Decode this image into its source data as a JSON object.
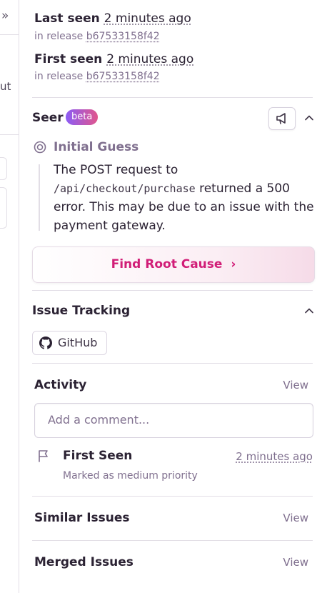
{
  "left_pane": {
    "collapse_glyph": "»",
    "cut_text": "ut"
  },
  "last_seen": {
    "label": "Last seen",
    "relative": "2 minutes ago",
    "release_prefix": "in release",
    "release": "b67533158f42"
  },
  "first_seen": {
    "label": "First seen",
    "relative": "2 minutes ago",
    "release_prefix": "in release",
    "release": "b67533158f42"
  },
  "seer": {
    "title": "Seer",
    "badge": "beta",
    "initial_guess": {
      "title": "Initial Guess",
      "text_before": "The POST request to ",
      "code": "/api/checkout/purchase",
      "text_after": " returned a 500 error. This may be due to an issue with the payment gateway."
    },
    "root_cause_button": "Find Root Cause",
    "root_cause_chevron": "›"
  },
  "issue_tracking": {
    "title": "Issue Tracking",
    "github_label": "GitHub"
  },
  "activity": {
    "title": "Activity",
    "view": "View",
    "comment_placeholder": "Add a comment...",
    "items": [
      {
        "title": "First Seen",
        "time": "2 minutes ago",
        "subtitle": "Marked as medium priority"
      }
    ]
  },
  "similar_issues": {
    "title": "Similar Issues",
    "view": "View"
  },
  "merged_issues": {
    "title": "Merged Issues",
    "view": "View"
  },
  "colors": {
    "accent": "#d11d77",
    "muted": "#80708f",
    "border": "#e2dee6",
    "beta_start": "#8b5cf6",
    "beta_end": "#e1568c"
  }
}
